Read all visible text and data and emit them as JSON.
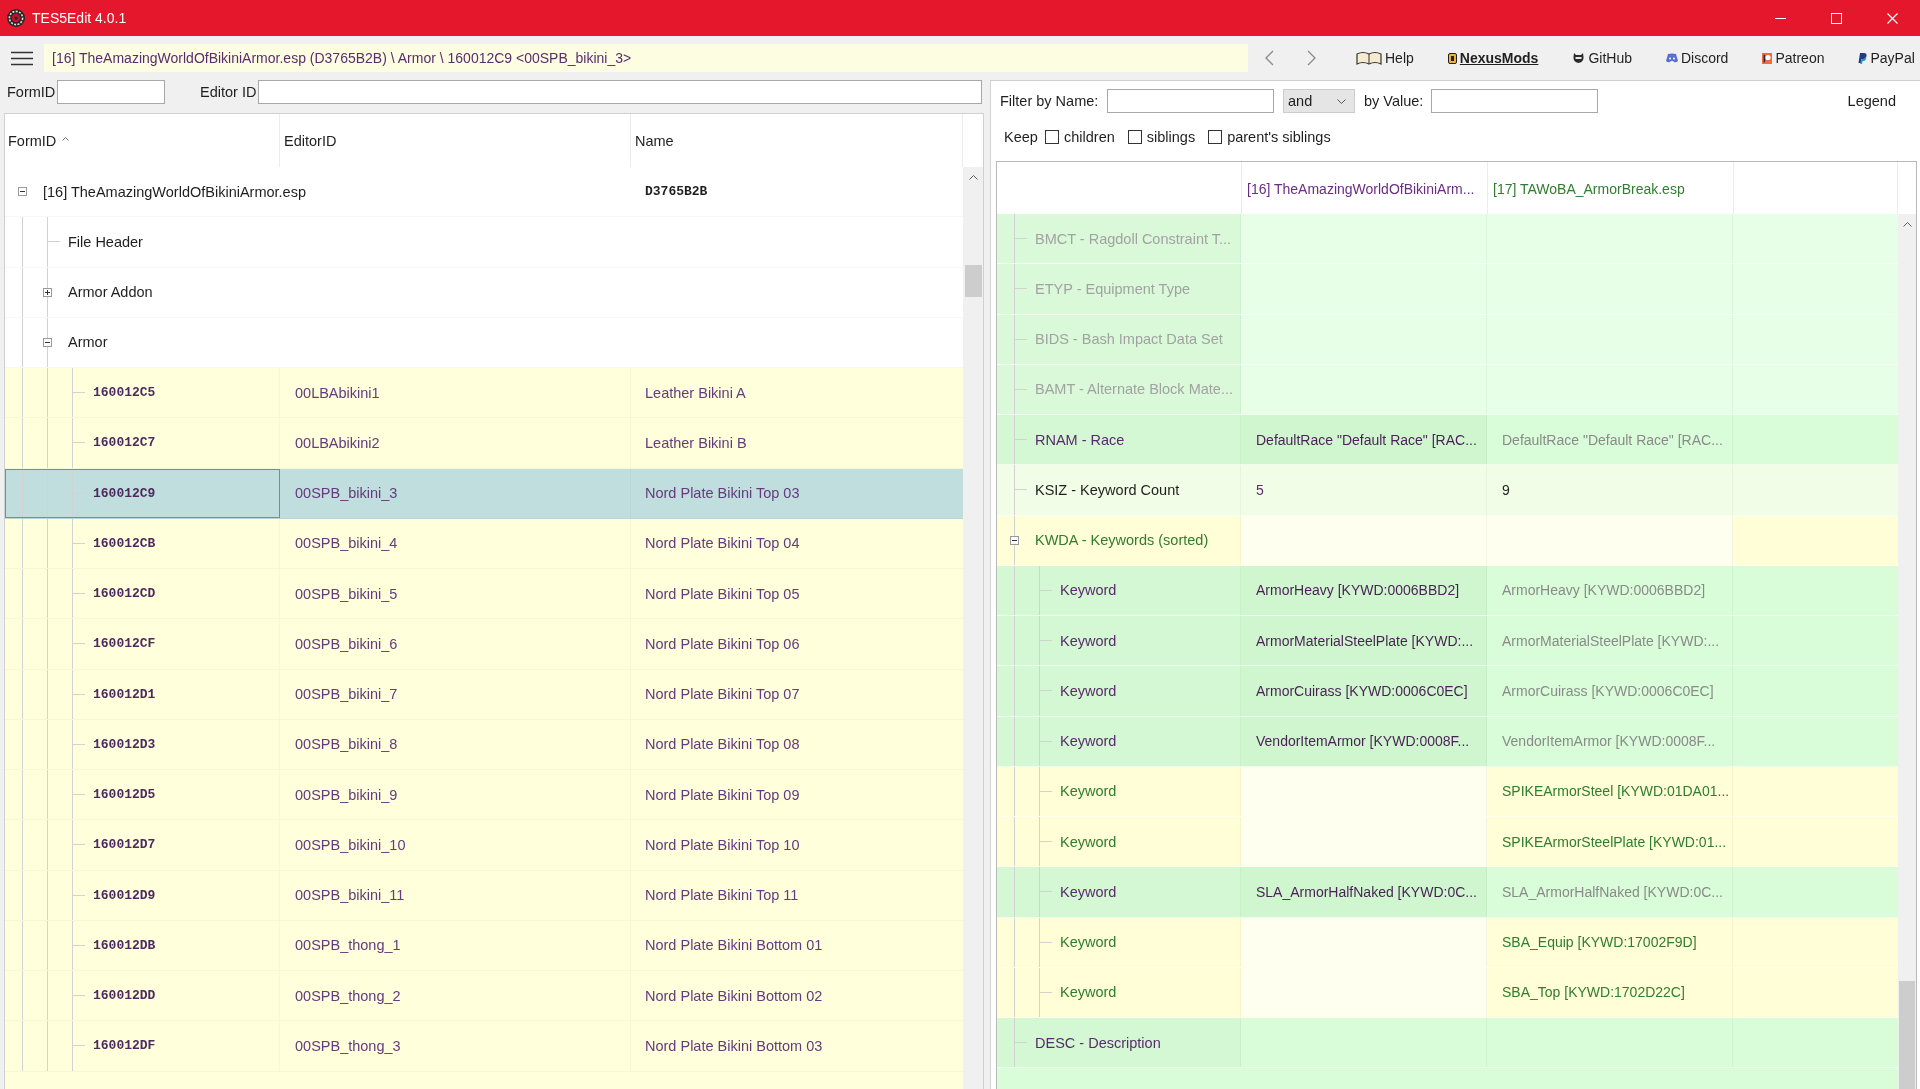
{
  "window": {
    "title": "TES5Edit 4.0.1"
  },
  "toolbar": {
    "path": "[16] TheAmazingWorldOfBikiniArmor.esp (D3765B2B) \\ Armor \\ 160012C9 <00SPB_bikini_3>",
    "links": [
      {
        "kind": "help",
        "label": "Help",
        "emphasized": false
      },
      {
        "kind": "nexus",
        "label": "NexusMods",
        "emphasized": true
      },
      {
        "kind": "github",
        "label": "GitHub",
        "emphasized": false
      },
      {
        "kind": "discord",
        "label": "Discord",
        "emphasized": false
      },
      {
        "kind": "patreon",
        "label": "Patreon",
        "emphasized": false
      },
      {
        "kind": "paypal",
        "label": "PayPal",
        "emphasized": false
      }
    ]
  },
  "record_list": {
    "filters": [
      {
        "label": "FormID"
      },
      {
        "label": "Editor ID"
      }
    ],
    "columns": [
      {
        "label": "FormID",
        "sorted": true
      },
      {
        "label": "EditorID",
        "sorted": false
      },
      {
        "label": "Name",
        "sorted": false
      }
    ],
    "tree": [
      {
        "kind": "file",
        "label": "[16] TheAmazingWorldOfBikiniArmor.esp",
        "name": "D3765B2B",
        "expanded": true,
        "children": [
          {
            "kind": "group",
            "label": "File Header"
          },
          {
            "kind": "group",
            "label": "Armor Addon",
            "expanded": false
          },
          {
            "kind": "group",
            "label": "Armor",
            "expanded": true,
            "children": [
              {
                "kind": "record",
                "form_id": "160012C5",
                "editor_id": "00LBAbikini1",
                "name": "Leather Bikini A",
                "selected": false
              },
              {
                "kind": "record",
                "form_id": "160012C7",
                "editor_id": "00LBAbikini2",
                "name": "Leather Bikini B",
                "selected": false
              },
              {
                "kind": "record",
                "form_id": "160012C9",
                "editor_id": "00SPB_bikini_3",
                "name": "Nord Plate Bikini Top 03",
                "selected": true
              },
              {
                "kind": "record",
                "form_id": "160012CB",
                "editor_id": "00SPB_bikini_4",
                "name": "Nord Plate Bikini Top 04",
                "selected": false
              },
              {
                "kind": "record",
                "form_id": "160012CD",
                "editor_id": "00SPB_bikini_5",
                "name": "Nord Plate Bikini Top 05",
                "selected": false
              },
              {
                "kind": "record",
                "form_id": "160012CF",
                "editor_id": "00SPB_bikini_6",
                "name": "Nord Plate Bikini Top 06",
                "selected": false
              },
              {
                "kind": "record",
                "form_id": "160012D1",
                "editor_id": "00SPB_bikini_7",
                "name": "Nord Plate Bikini Top 07",
                "selected": false
              },
              {
                "kind": "record",
                "form_id": "160012D3",
                "editor_id": "00SPB_bikini_8",
                "name": "Nord Plate Bikini Top 08",
                "selected": false
              },
              {
                "kind": "record",
                "form_id": "160012D5",
                "editor_id": "00SPB_bikini_9",
                "name": "Nord Plate Bikini Top 09",
                "selected": false
              },
              {
                "kind": "record",
                "form_id": "160012D7",
                "editor_id": "00SPB_bikini_10",
                "name": "Nord Plate Bikini Top 10",
                "selected": false
              },
              {
                "kind": "record",
                "form_id": "160012D9",
                "editor_id": "00SPB_bikini_11",
                "name": "Nord Plate Bikini Top 11",
                "selected": false
              },
              {
                "kind": "record",
                "form_id": "160012DB",
                "editor_id": "00SPB_thong_1",
                "name": "Nord Plate Bikini Bottom 01",
                "selected": false
              },
              {
                "kind": "record",
                "form_id": "160012DD",
                "editor_id": "00SPB_thong_2",
                "name": "Nord Plate Bikini Bottom 02",
                "selected": false
              },
              {
                "kind": "record",
                "form_id": "160012DF",
                "editor_id": "00SPB_thong_3",
                "name": "Nord Plate Bikini Bottom 03",
                "selected": false
              }
            ]
          }
        ]
      }
    ]
  },
  "record_view": {
    "filter": {
      "name_label": "Filter by Name:",
      "operator": "and",
      "value_label": "by Value:",
      "legend": "Legend"
    },
    "keep": {
      "label": "Keep",
      "options": [
        {
          "label": "children",
          "checked": false
        },
        {
          "label": "siblings",
          "checked": false
        },
        {
          "label": "parent's siblings",
          "checked": false
        }
      ]
    },
    "columns": [
      {
        "label": "[16] TheAmazingWorldOfBikiniArm...",
        "color": "#6b2d84"
      },
      {
        "label": "[17] TAWoBA_ArmorBreak.esp",
        "color": "#2f7d2f"
      }
    ],
    "rows": [
      {
        "label": "BMCT - Ragdoll Constraint T...",
        "kind": "unused"
      },
      {
        "label": "ETYP - Equipment Type",
        "kind": "unused"
      },
      {
        "label": "BIDS - Bash Impact Data Set",
        "kind": "unused"
      },
      {
        "label": "BAMT - Alternate Block Mate...",
        "kind": "unused"
      },
      {
        "label": "RNAM - Race",
        "kind": "identical",
        "cells": [
          {
            "text": "DefaultRace \"Default Race\" [RAC...",
            "color": "#4a1f55"
          },
          {
            "text": "DefaultRace \"Default Race\" [RAC...",
            "color": "#8a8a8a"
          }
        ]
      },
      {
        "label": "KSIZ - Keyword Count",
        "kind": "benign",
        "cells": [
          {
            "text": "5",
            "color": "#5b2a6e"
          },
          {
            "text": "9",
            "color": "#1f1f1f"
          }
        ]
      },
      {
        "label": "KWDA - Keywords (sorted)",
        "kind": "injected",
        "expanded": true,
        "children": [
          {
            "label": "Keyword",
            "kind": "identical",
            "cells": [
              {
                "text": "ArmorHeavy [KYWD:0006BBD2]",
                "color": "#4a1f55"
              },
              {
                "text": "ArmorHeavy [KYWD:0006BBD2]",
                "color": "#8a8a8a"
              }
            ]
          },
          {
            "label": "Keyword",
            "kind": "identical",
            "cells": [
              {
                "text": "ArmorMaterialSteelPlate [KYWD:...",
                "color": "#4a1f55"
              },
              {
                "text": "ArmorMaterialSteelPlate [KYWD:...",
                "color": "#8a8a8a"
              }
            ]
          },
          {
            "label": "Keyword",
            "kind": "identical",
            "cells": [
              {
                "text": "ArmorCuirass [KYWD:0006C0EC]",
                "color": "#4a1f55"
              },
              {
                "text": "ArmorCuirass [KYWD:0006C0EC]",
                "color": "#8a8a8a"
              }
            ]
          },
          {
            "label": "Keyword",
            "kind": "identical",
            "cells": [
              {
                "text": "VendorItemArmor [KYWD:0008F...",
                "color": "#4a1f55"
              },
              {
                "text": "VendorItemArmor [KYWD:0008F...",
                "color": "#8a8a8a"
              }
            ]
          },
          {
            "label": "Keyword",
            "kind": "injected",
            "cells": [
              null,
              {
                "text": "SPIKEArmorSteel [KYWD:01DA01...",
                "color": "#2f7d2f"
              }
            ]
          },
          {
            "label": "Keyword",
            "kind": "injected",
            "cells": [
              null,
              {
                "text": "SPIKEArmorSteelPlate [KYWD:01...",
                "color": "#2f7d2f"
              }
            ]
          },
          {
            "label": "Keyword",
            "kind": "identical",
            "cells": [
              {
                "text": "SLA_ArmorHalfNaked [KYWD:0C...",
                "color": "#4a1f55"
              },
              {
                "text": "SLA_ArmorHalfNaked [KYWD:0C...",
                "color": "#8a8a8a"
              }
            ]
          },
          {
            "label": "Keyword",
            "kind": "injected",
            "cells": [
              null,
              {
                "text": "SBA_Equip [KYWD:17002F9D]",
                "color": "#2f7d2f"
              }
            ]
          },
          {
            "label": "Keyword",
            "kind": "injected",
            "cells": [
              null,
              {
                "text": "SBA_Top [KYWD:1702D22C]",
                "color": "#2f7d2f"
              }
            ]
          }
        ]
      },
      {
        "label": "DESC - Description",
        "kind": "identical"
      }
    ]
  }
}
